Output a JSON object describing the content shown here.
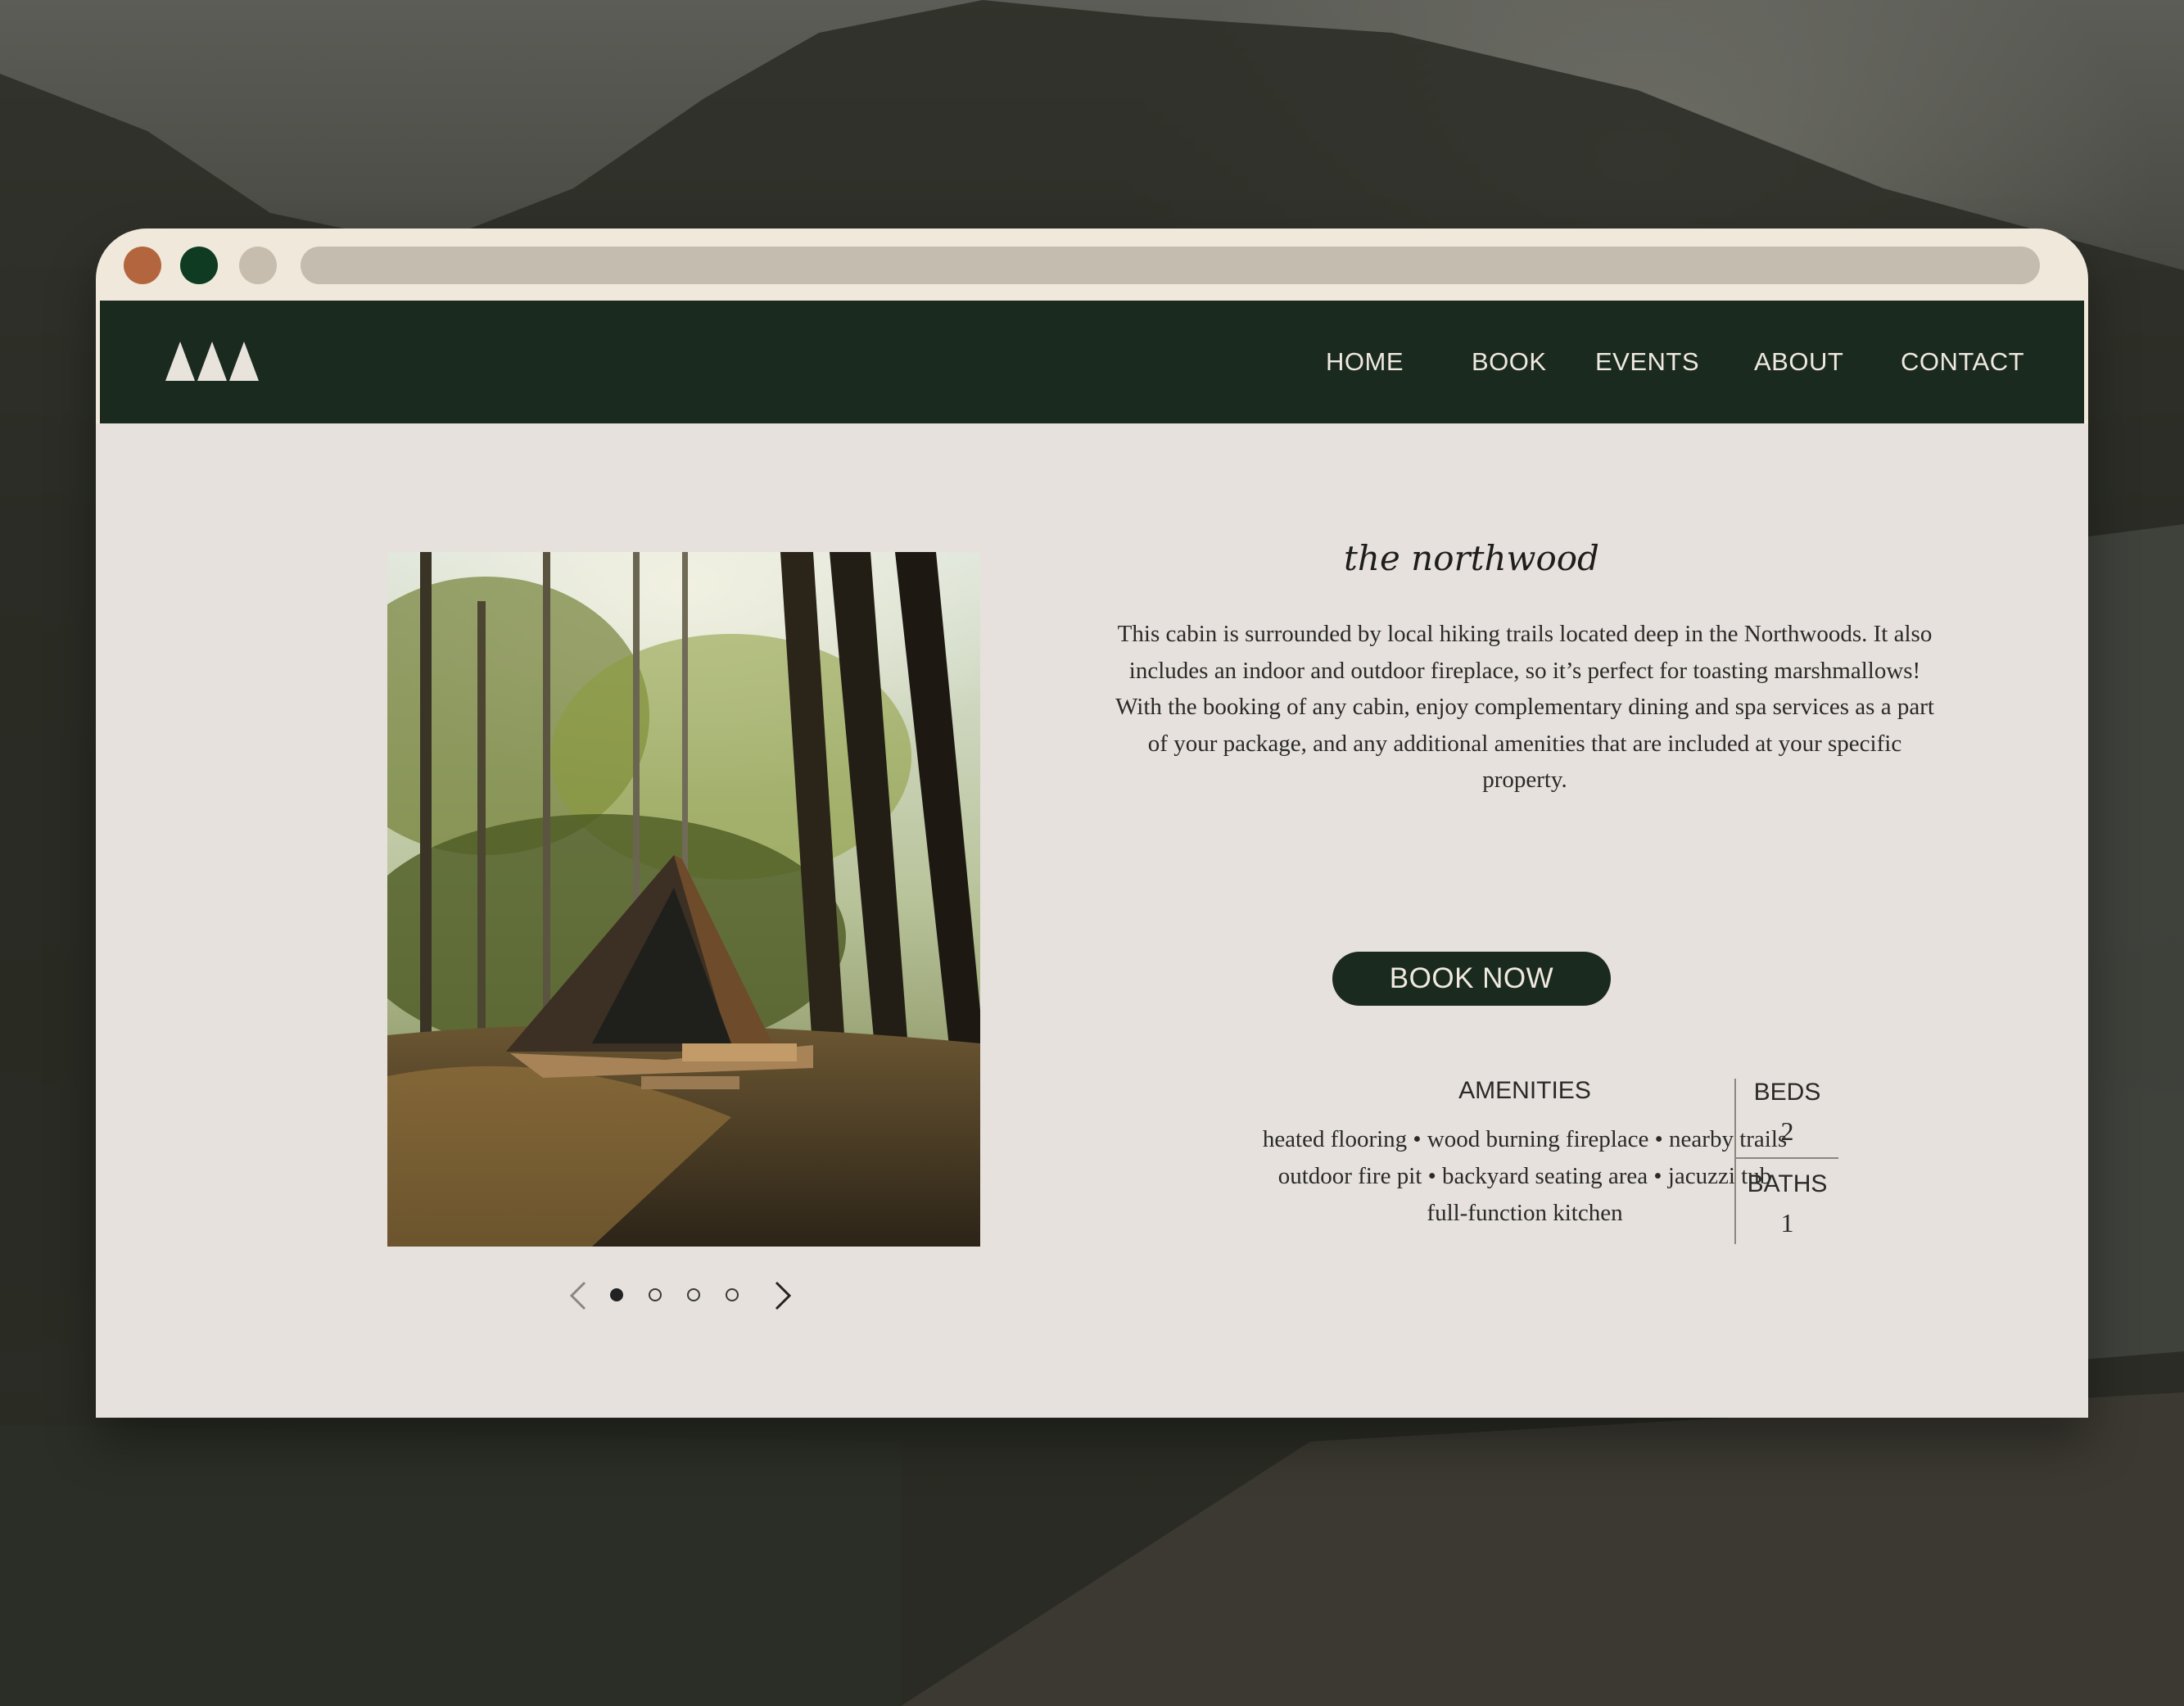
{
  "nav": {
    "items": [
      "HOME",
      "BOOK",
      "EVENTS",
      "ABOUT",
      "CONTACT"
    ]
  },
  "cabin": {
    "title": "the northwood",
    "description": [
      "This cabin is surrounded by local hiking trails located deep in the Northwoods. It also includes an indoor and outdoor fireplace, so it’s perfect for toasting marshmallows!",
      "With the booking of any cabin, enjoy complementary dining and spa services as a part of your package, and any additional amenities that are included at your specific property."
    ],
    "cta_label": "BOOK NOW"
  },
  "amenities": {
    "heading": "AMENITIES",
    "lines": [
      "heated flooring • wood burning fireplace • nearby trails",
      "outdoor fire pit • backyard seating area • jacuzzi tub",
      "full-function kitchen"
    ]
  },
  "stats": {
    "beds_label": "BEDS",
    "beds_value": "2",
    "baths_label": "BATHS",
    "baths_value": "1"
  },
  "carousel": {
    "total": 4,
    "active": 1
  },
  "icons": {
    "logo": "three-trees-logo",
    "prev": "chevron-left-icon",
    "next": "chevron-right-icon"
  },
  "colors": {
    "window_chrome": "#efe8db",
    "nav_bg": "#1b2a1f",
    "page_bg": "#e6e1dc",
    "dot_red": "#b3653e",
    "dot_green": "#0f3b22",
    "dot_grey": "#c6bdaf",
    "button_bg": "#1b2a1f",
    "button_text": "#efe9df"
  }
}
